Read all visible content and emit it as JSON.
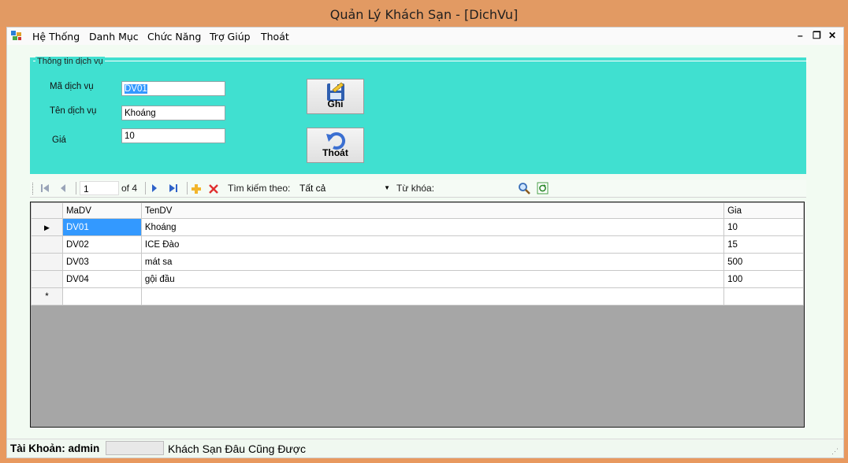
{
  "window": {
    "title": "Quản Lý Khách Sạn - [DichVu]"
  },
  "menu": {
    "items": [
      "Hệ Thống",
      "Danh Mục",
      "Chức Năng",
      "Trợ Giúp",
      "Thoát"
    ],
    "mdi_min": "–",
    "mdi_restore": "❐",
    "mdi_close": "✕"
  },
  "group": {
    "title": "Thông tin dịch vụ",
    "ma_label": "Mã dịch vụ",
    "ma_value": "DV01",
    "ten_label": "Tên dịch vụ",
    "ten_value": "Khoáng",
    "gia_label": "Giá",
    "gia_value": "10",
    "save_label": "Ghi",
    "exit_label": "Thoát"
  },
  "navigator": {
    "position": "1",
    "count_text": "of 4",
    "search_by_label": "Tìm kiếm theo:",
    "search_by_value": "Tất cả",
    "keyword_label": "Từ khóa:",
    "keyword_value": ""
  },
  "grid": {
    "columns": [
      "MaDV",
      "TenDV",
      "Gia"
    ],
    "rows": [
      [
        "DV01",
        "Khoáng",
        "10"
      ],
      [
        "DV02",
        "ICE Đào",
        "15"
      ],
      [
        "DV03",
        "mát sa",
        "500"
      ],
      [
        "DV04",
        "gội đầu",
        "100"
      ]
    ],
    "current_row_marker": "▶",
    "new_row_marker": "*"
  },
  "status": {
    "account_label": "Tài Khoản: admin",
    "field_value": "",
    "hotel_text": "Khách Sạn  Đâu Cũng Được"
  },
  "colors": {
    "panel": "#40e0d0",
    "titlebar": "#e29a63",
    "selection": "#3399ff"
  }
}
